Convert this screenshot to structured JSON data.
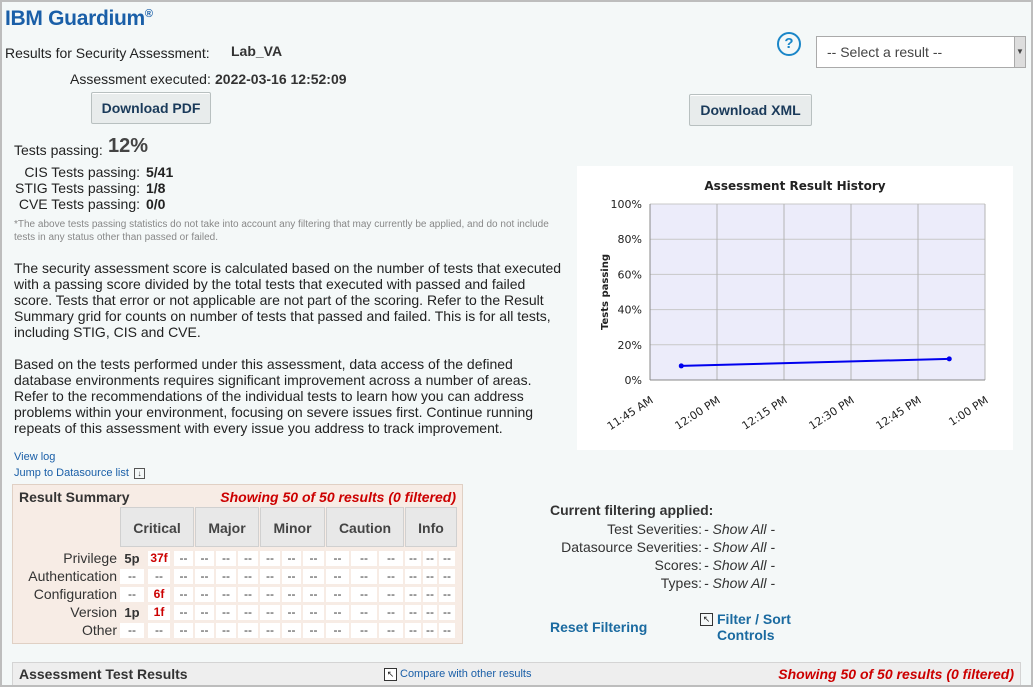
{
  "header": {
    "logo": "IBM Guardium",
    "logo_mark": "®",
    "results_for_label": "Results for Security Assessment:",
    "assessment_name": "Lab_VA",
    "executed_label": "Assessment executed:",
    "executed_value": "2022-03-16 12:52:09",
    "help_glyph": "?",
    "select_placeholder": "-- Select a result --"
  },
  "buttons": {
    "download_pdf": "Download PDF",
    "download_xml": "Download XML"
  },
  "stats": {
    "tests_passing_label": "Tests passing:",
    "tests_passing_value": "12%",
    "cis_label": "CIS Tests passing:",
    "cis_value": "5/41",
    "stig_label": "STIG Tests passing:",
    "stig_value": "1/8",
    "cve_label": "CVE Tests passing:",
    "cve_value": "0/0",
    "note": "*The above tests passing statistics do not take into account any filtering that may currently be applied, and do not include tests in any status other than passed or failed."
  },
  "description": {
    "p1": "The security assessment score is calculated based on the number of tests that executed with a passing score divided by the total tests that executed with passed and failed score. Tests that error or not applicable are not part of the scoring. Refer to the Result Summary grid for counts on number of tests that passed and failed. This is for all tests, including STIG, CIS and CVE.",
    "p2": "Based on the tests performed under this assessment, data access of the defined database environments requires significant improvement across a number of areas. Refer to the recommendations of the individual tests to learn how you can address problems within your environment, focusing on severe issues first. Continue running repeats of this assessment with every issue you address to track improvement."
  },
  "links": {
    "view_log": "View log",
    "jump_datasource": "Jump to Datasource list"
  },
  "summary": {
    "title": "Result Summary",
    "showing": "Showing 50 of 50 results (0 filtered)",
    "columns": [
      "Critical",
      "Major",
      "Minor",
      "Caution",
      "Info"
    ],
    "rows": [
      {
        "label": "Privilege",
        "cells": [
          "5p",
          "37f",
          "--",
          "--",
          "--",
          "--",
          "--",
          "--",
          "--",
          "--",
          "--",
          "--",
          "--",
          "--",
          "--"
        ]
      },
      {
        "label": "Authentication",
        "cells": [
          "--",
          "--",
          "--",
          "--",
          "--",
          "--",
          "--",
          "--",
          "--",
          "--",
          "--",
          "--",
          "--",
          "--",
          "--"
        ]
      },
      {
        "label": "Configuration",
        "cells": [
          "--",
          "6f",
          "--",
          "--",
          "--",
          "--",
          "--",
          "--",
          "--",
          "--",
          "--",
          "--",
          "--",
          "--",
          "--"
        ]
      },
      {
        "label": "Version",
        "cells": [
          "1p",
          "1f",
          "--",
          "--",
          "--",
          "--",
          "--",
          "--",
          "--",
          "--",
          "--",
          "--",
          "--",
          "--",
          "--"
        ]
      },
      {
        "label": "Other",
        "cells": [
          "--",
          "--",
          "--",
          "--",
          "--",
          "--",
          "--",
          "--",
          "--",
          "--",
          "--",
          "--",
          "--",
          "--",
          "--"
        ]
      }
    ]
  },
  "filtering": {
    "title": "Current filtering applied:",
    "items": [
      {
        "label": "Test Severities:",
        "value": "- Show All -"
      },
      {
        "label": "Datasource Severities:",
        "value": "- Show All -"
      },
      {
        "label": "Scores:",
        "value": "- Show All -"
      },
      {
        "label": "Types:",
        "value": "- Show All -"
      }
    ],
    "reset": "Reset Filtering",
    "filter_sort_1": "Filter / Sort",
    "filter_sort_2": "Controls"
  },
  "results_bar": {
    "title": "Assessment Test Results",
    "compare": "Compare with other results",
    "showing": "Showing 50 of 50 results (0 filtered)"
  },
  "colors": {
    "brand": "#1a5fa8",
    "line": "#0000ee",
    "plot_bg": "#ececfa",
    "fail": "#cc0000"
  },
  "chart_data": {
    "type": "line",
    "title": "Assessment Result History",
    "xlabel": "",
    "ylabel": "Tests passing",
    "x_ticks": [
      "11:45 AM",
      "12:00 PM",
      "12:15 PM",
      "12:30 PM",
      "12:45 PM",
      "1:00 PM"
    ],
    "y_ticks": [
      "0%",
      "20%",
      "40%",
      "60%",
      "80%",
      "100%"
    ],
    "ylim": [
      0,
      100
    ],
    "x_range": [
      "11:45 AM",
      "1:00 PM"
    ],
    "grid": true,
    "series": [
      {
        "points": [
          {
            "x": "11:52 AM",
            "y": 8
          },
          {
            "x": "12:52 PM",
            "y": 12
          }
        ]
      }
    ]
  }
}
